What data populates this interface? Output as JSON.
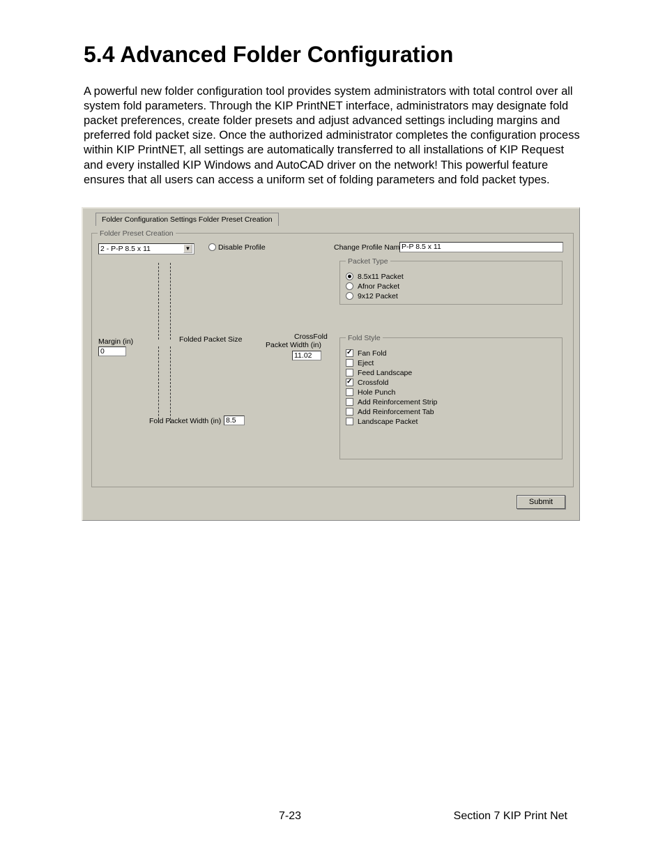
{
  "heading": "5.4 Advanced Folder Configuration",
  "paragraph": "A powerful new folder configuration tool provides system administrators with total control over all system fold parameters. Through the KIP PrintNET interface, administrators may designate fold packet preferences, create folder presets and adjust advanced settings including margins and preferred fold packet size. Once the authorized administrator completes the configuration process within KIP PrintNET, all settings are automatically transferred to all installations of KIP Request and every installed KIP Windows and AutoCAD driver on the network! This powerful feature ensures that all users can access a uniform set of folding parameters and fold packet types.",
  "tab_label": "Folder Configuration Settings Folder Preset Creation",
  "fp_legend": "Folder Preset Creation",
  "combo_value": "2 - P-P 8.5 x 11",
  "disable_profile_label": "Disable Profile",
  "change_name_label": "Change Profile Name:",
  "change_name_value": "P-P 8.5 x  11",
  "packet_type": {
    "legend": "Packet Type",
    "options": [
      "8.5x11 Packet",
      "Afnor Packet",
      "9x12 Packet"
    ],
    "selected": 0
  },
  "fold_style": {
    "legend": "Fold Style",
    "options": [
      {
        "label": "Fan Fold",
        "checked": true
      },
      {
        "label": "Eject",
        "checked": false
      },
      {
        "label": "Feed Landscape",
        "checked": false
      },
      {
        "label": "Crossfold",
        "checked": true
      },
      {
        "label": "Hole Punch",
        "checked": false
      },
      {
        "label": "Add Reinforcement Strip",
        "checked": false
      },
      {
        "label": "Add Reinforcement Tab",
        "checked": false
      },
      {
        "label": "Landscape Packet",
        "checked": false
      }
    ]
  },
  "diagram": {
    "margin_label": "Margin (in)",
    "margin_value": "0",
    "folded_label": "Folded Packet Size",
    "crossfold_label": "CrossFold",
    "packet_width_label": "Packet Width (in)",
    "crossfold_value": "11.02",
    "fold_packet_width_label": "Fold Packet Width (in)",
    "fold_packet_width_value": "8.5"
  },
  "submit_label": "Submit",
  "footer_page": "7-23",
  "footer_section": "Section 7   KIP Print Net"
}
